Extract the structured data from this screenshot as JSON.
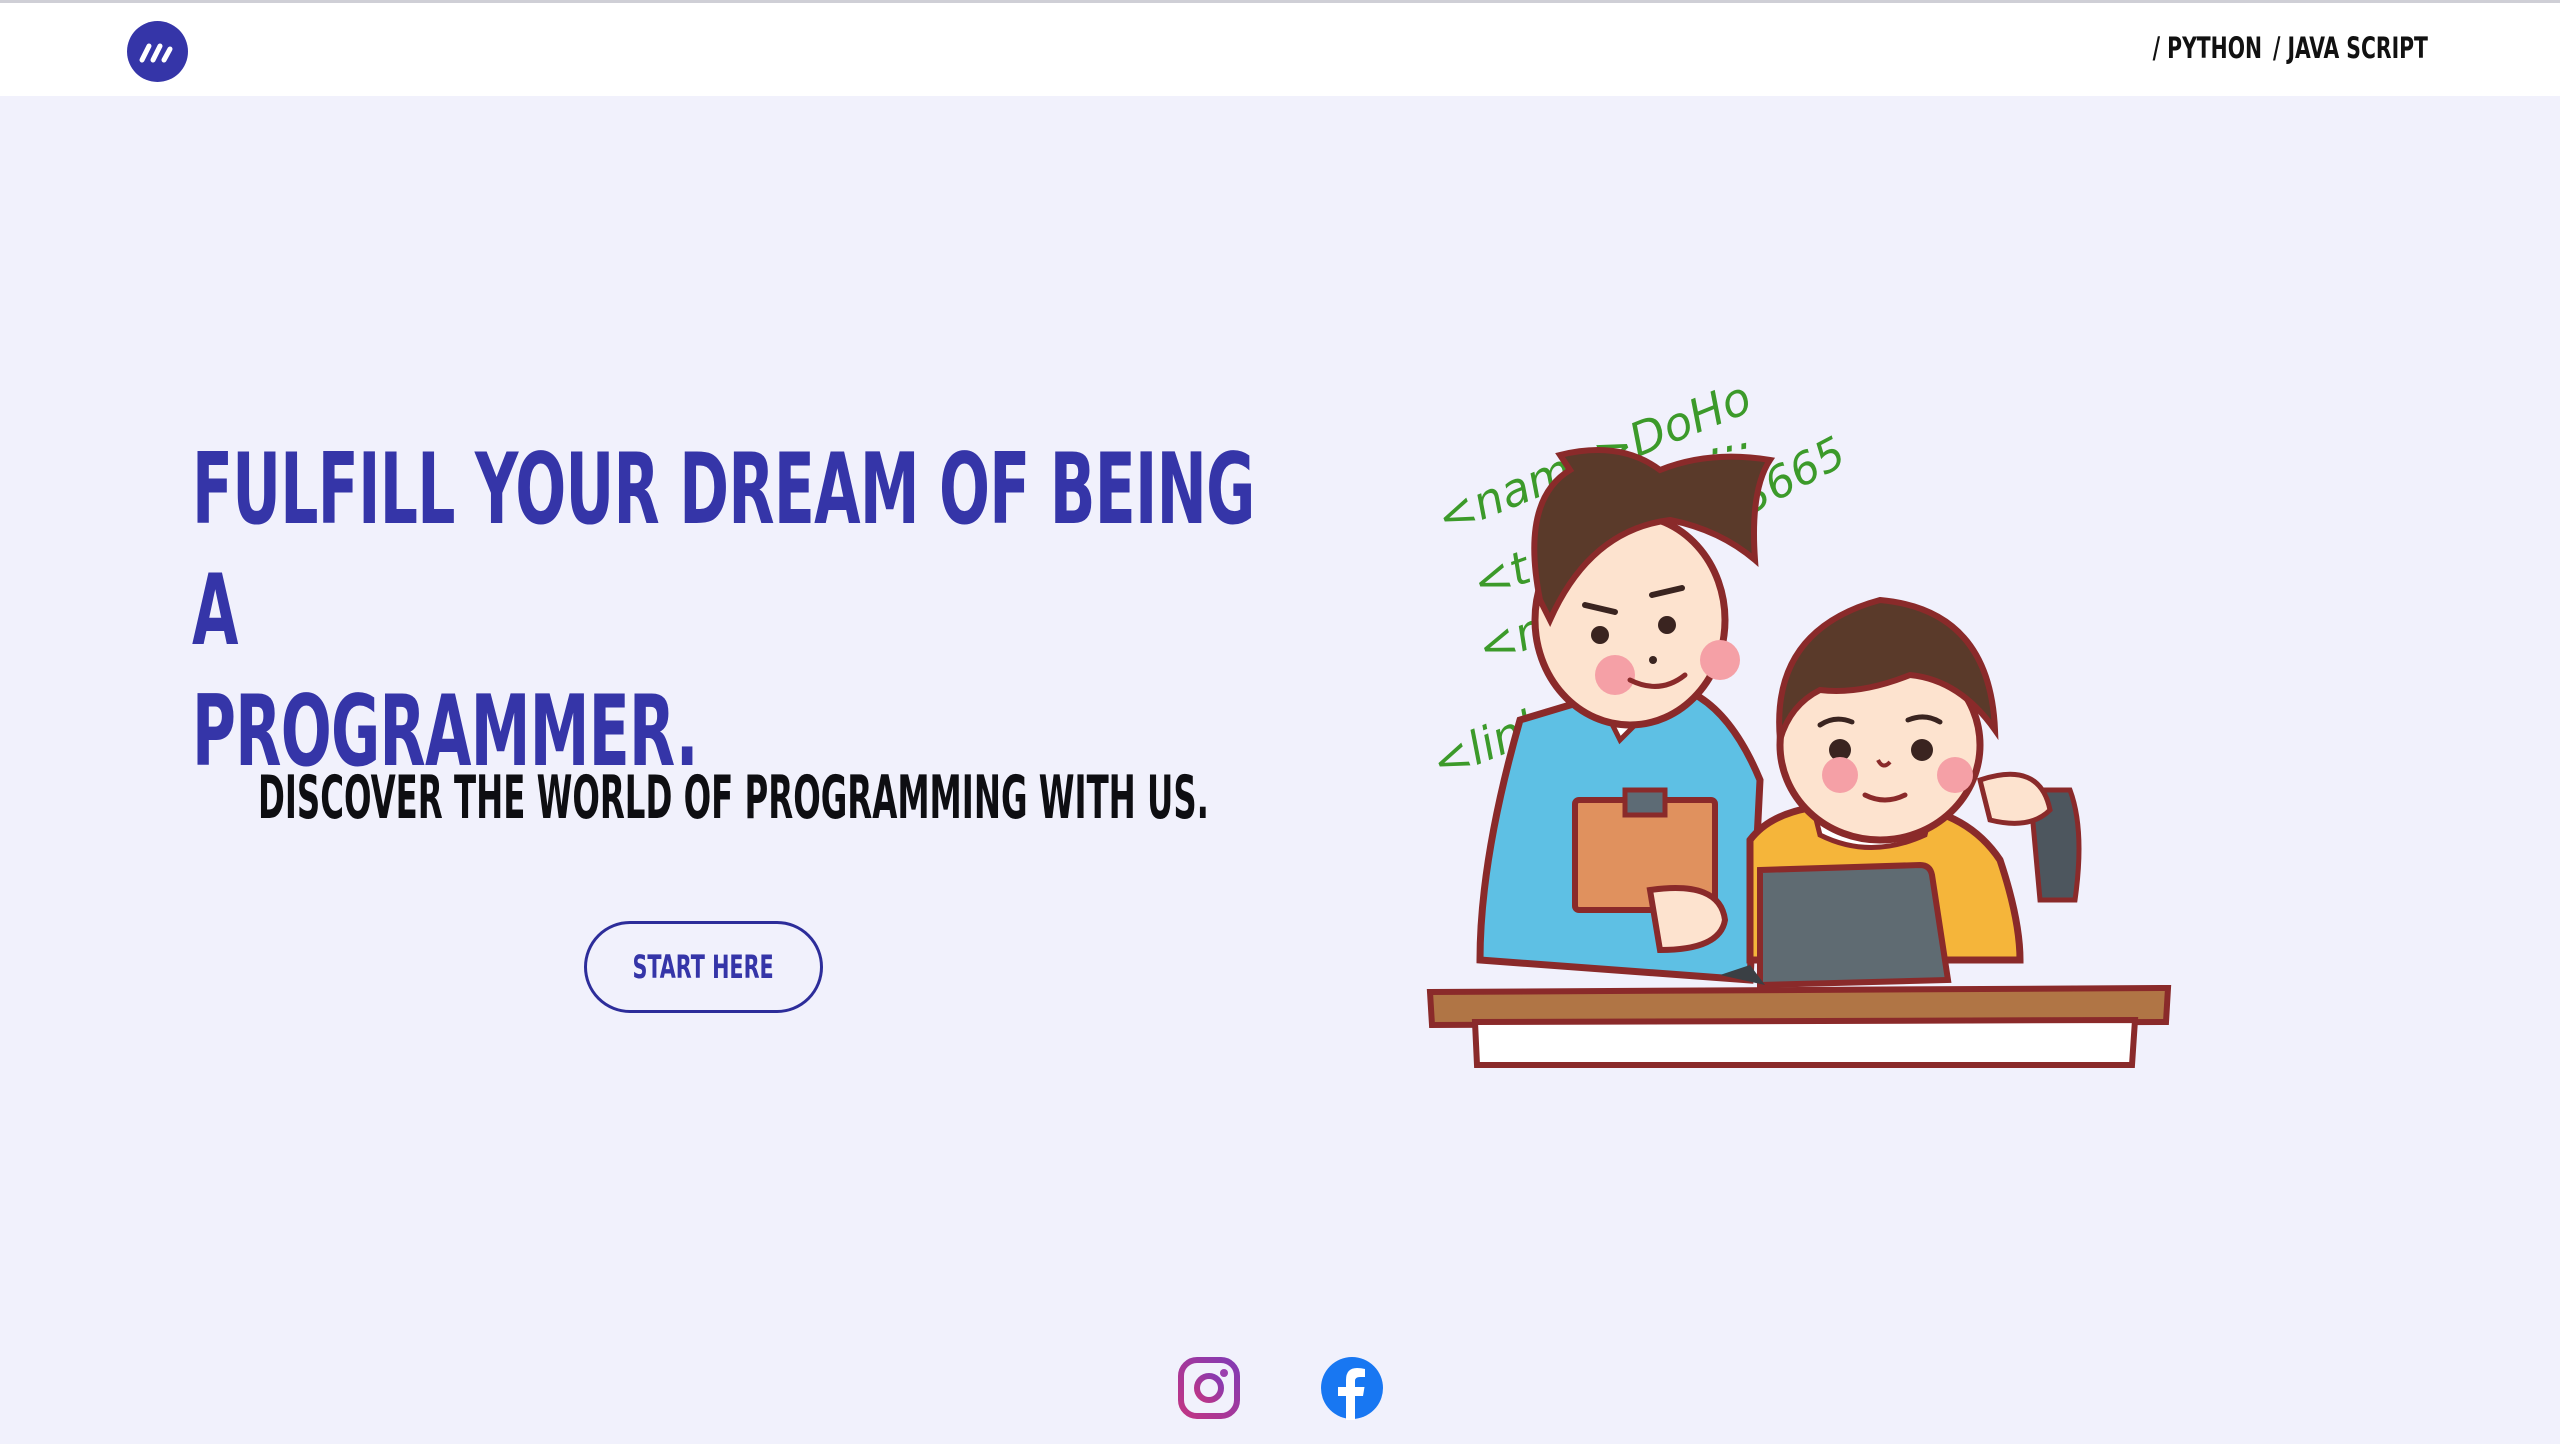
{
  "header": {
    "logo_icon": "brand-logo-icon",
    "nav": [
      {
        "label": "/ PYTHON"
      },
      {
        "label": "/ JAVA SCRIPT"
      }
    ]
  },
  "hero": {
    "title_line1": "FULFILL YOUR DREAM OF BEING A",
    "title_line2": "PROGRAMMER.",
    "subtitle": "DISCOVER THE WORLD OF PROGRAMMING WITH US.",
    "cta_label": "START HERE"
  },
  "illustration": {
    "code_lines": [
      "<name>DoHo",
      "<t",
      "<m",
      "<link>",
      "...",
      "3665"
    ]
  },
  "social": [
    {
      "name": "instagram-icon"
    },
    {
      "name": "facebook-icon"
    }
  ],
  "colors": {
    "accent": "#3535a8",
    "background": "#f1f1fc",
    "header_bg": "#ffffff",
    "text_dark": "#111111",
    "code_green": "#3c9a2a"
  }
}
